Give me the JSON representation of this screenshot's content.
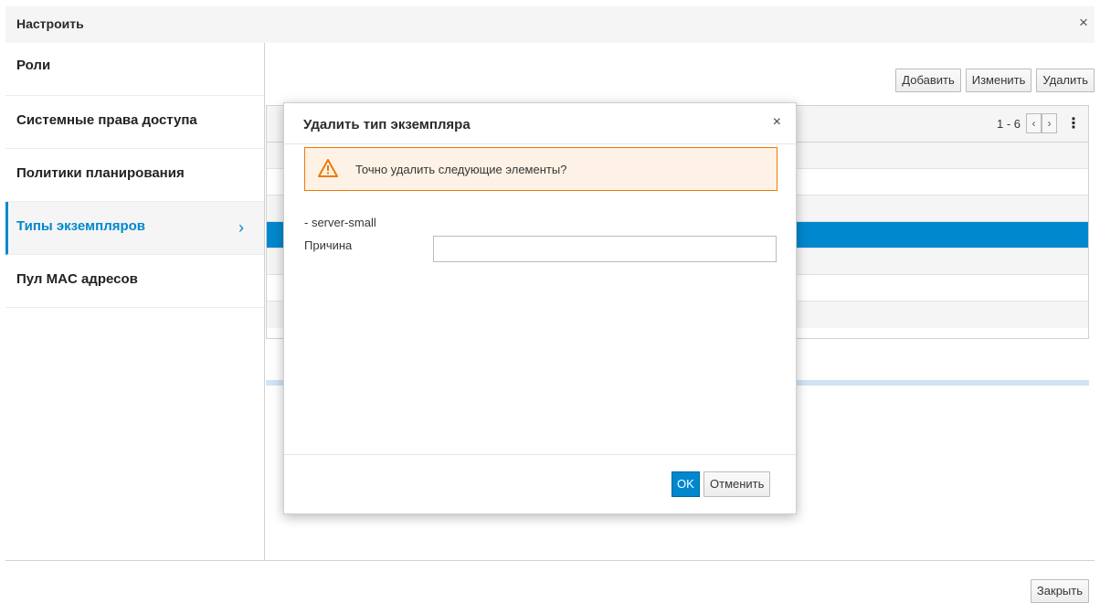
{
  "window": {
    "title": "Настроить",
    "close_glyph": "×"
  },
  "sidebar": {
    "items": [
      {
        "label": "Роли"
      },
      {
        "label": "Системные права доступа"
      },
      {
        "label": "Политики планирования"
      },
      {
        "label": "Типы экземпляров",
        "active": true,
        "chevron": "›"
      },
      {
        "label": "Пул MAC адресов"
      }
    ]
  },
  "toolbar": {
    "add_label": "Добавить",
    "edit_label": "Изменить",
    "delete_label": "Удалить"
  },
  "grid": {
    "pager_text": "1 - 6",
    "prev_glyph": "‹",
    "next_glyph": "›",
    "kebab_glyph": "⋮"
  },
  "dialog": {
    "title": "Удалить тип экземпляра",
    "close_glyph": "×",
    "warning_text": "Точно удалить следующие элементы?",
    "item_line": "- server-small",
    "reason_label": "Причина",
    "reason_value": "",
    "ok_label": "OK",
    "cancel_label": "Отменить"
  },
  "footer": {
    "close_label": "Закрыть"
  },
  "colors": {
    "accent": "#0088ce",
    "warning_border": "#ec7a08",
    "warning_bg": "#fdf2e5"
  }
}
